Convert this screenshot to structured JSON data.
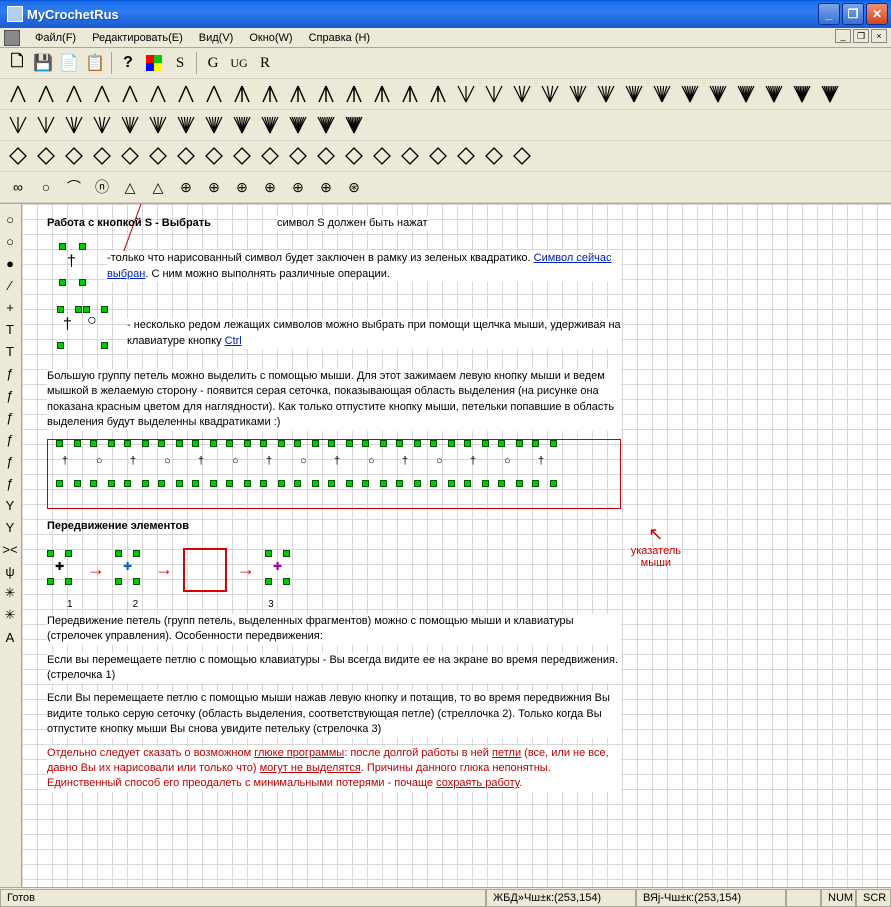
{
  "window": {
    "title": "MyCrochetRus"
  },
  "menu": {
    "file": "Файл(F)",
    "edit": "Редактировать(E)",
    "view": "Вид(V)",
    "window": "Окно(W)",
    "help": "Справка (H)"
  },
  "toolbar1": {
    "letters": [
      "S",
      "G",
      "UG",
      "R"
    ]
  },
  "leftbar_glyphs": [
    "○",
    "○",
    "●",
    "∕",
    "+",
    "T",
    "T",
    "ƒ",
    "ƒ",
    "ƒ",
    "ƒ",
    "ƒ",
    "ƒ",
    "Y",
    "Y",
    "><",
    "ψ",
    "✳",
    "✳",
    "A"
  ],
  "doc": {
    "h1": "Работа с кнопкой S - Выбрать",
    "note_s": "символ S должен быть нажат",
    "p1a": "-только что нарисованный символ будет заключен в рамку из зеленых квадратико. ",
    "p1b": "Символ сейчас выбран",
    "p1c": ". С ним можно выполнять различные операции.",
    "p2a": "- несколько редом лежащих символов можно выбрать при помощи щелчка мыши, удерживая на клавиатуре кнопку ",
    "p2b": "Ctrl",
    "p3": "Большую группу петель можно выделить с помощью мыши. Для этот зажимаем левую кнопку мыши и ведем мышкой в желаемую сторону - появится серая сеточка, показывающая область выделения (на рисунке она показана красным цветом для наглядности). Как только отпустите кнопку мыши, петельки попавшие в область выделения будут выделенны квадратиками :)",
    "h2": "Передвижение элементов",
    "p4": "Передвижение петель (групп петель, выделенных фрагментов) можно с помощью мыши и клавиатуры (стрелочек управления). Особенности передвижения:",
    "p5": "Если вы перемещаете петлю с помощью клавиатуры - Вы всегда видите ее на экране во время передвижения. (стрелочка 1)",
    "p6": "Если Вы перемещаете петлю с помощью мыши нажав левую кнопку и потащив, то во время передвижния Вы видите только серую сеточку (область выделения, соответствующая петле) (стреллочка 2). Только когда Вы отпустите кнопку мыши Вы снова увидите петельку (стрелочка 3)",
    "p7a": "Отдельно следует сказать о возможном ",
    "p7b": "глюке программы",
    "p7c": ": после долгой работы в ней ",
    "p7d": "петли",
    "p7e": " (все, или не все, давно Вы их нарисовали или только что) ",
    "p7f": "могут не выделятся",
    "p7g": ". Причины данного глюка непонятны. Единственный способ его преодалеть с минимальными потерями - почаще ",
    "p7h": "сохраять работу",
    "p7i": ".",
    "nums": {
      "n1": "1",
      "n2": "2",
      "n3": "3"
    },
    "mouse_label_1": "указатель",
    "mouse_label_2": "мыши"
  },
  "status": {
    "ready": "Готов",
    "coord1": "ЖБД»Чш±к:(253,154)",
    "coord2": "ВЯј-Чш±к:(253,154)",
    "num": "NUM",
    "scr": "SCR"
  }
}
